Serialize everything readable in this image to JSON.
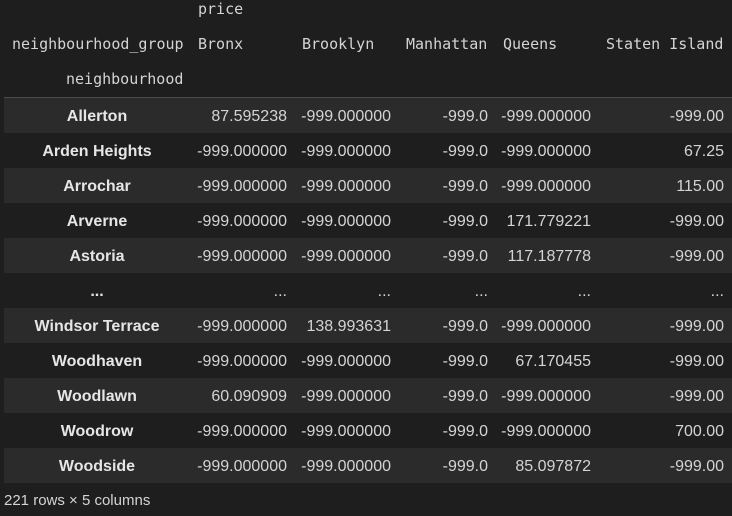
{
  "header": {
    "column_level_label": "price",
    "columns_name": "neighbourhood_group",
    "index_name": "neighbourhood",
    "columns": [
      "Bronx",
      "Brooklyn",
      "Manhattan",
      "Queens",
      "Staten Island"
    ]
  },
  "rows": [
    {
      "name": "Allerton",
      "values": [
        "87.595238",
        "-999.000000",
        "-999.0",
        "-999.000000",
        "-999.00"
      ]
    },
    {
      "name": "Arden Heights",
      "values": [
        "-999.000000",
        "-999.000000",
        "-999.0",
        "-999.000000",
        "67.25"
      ]
    },
    {
      "name": "Arrochar",
      "values": [
        "-999.000000",
        "-999.000000",
        "-999.0",
        "-999.000000",
        "115.00"
      ]
    },
    {
      "name": "Arverne",
      "values": [
        "-999.000000",
        "-999.000000",
        "-999.0",
        "171.779221",
        "-999.00"
      ]
    },
    {
      "name": "Astoria",
      "values": [
        "-999.000000",
        "-999.000000",
        "-999.0",
        "117.187778",
        "-999.00"
      ]
    },
    {
      "name": "...",
      "values": [
        "...",
        "...",
        "...",
        "...",
        "..."
      ]
    },
    {
      "name": "Windsor Terrace",
      "values": [
        "-999.000000",
        "138.993631",
        "-999.0",
        "-999.000000",
        "-999.00"
      ]
    },
    {
      "name": "Woodhaven",
      "values": [
        "-999.000000",
        "-999.000000",
        "-999.0",
        "67.170455",
        "-999.00"
      ]
    },
    {
      "name": "Woodlawn",
      "values": [
        "60.090909",
        "-999.000000",
        "-999.0",
        "-999.000000",
        "-999.00"
      ]
    },
    {
      "name": "Woodrow",
      "values": [
        "-999.000000",
        "-999.000000",
        "-999.0",
        "-999.000000",
        "700.00"
      ]
    },
    {
      "name": "Woodside",
      "values": [
        "-999.000000",
        "-999.000000",
        "-999.0",
        "85.097872",
        "-999.00"
      ]
    }
  ],
  "footer": {
    "summary": "221 rows × 5 columns"
  }
}
